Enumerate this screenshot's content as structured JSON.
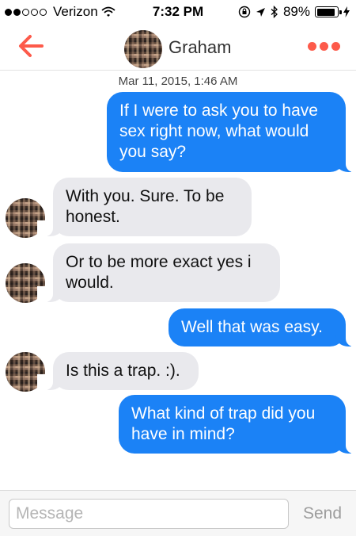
{
  "status_bar": {
    "carrier": "Verizon",
    "time": "7:32 PM",
    "battery": "89%",
    "battery_level": 0.89,
    "signal_bars": 2
  },
  "header": {
    "contact_name": "Graham",
    "accent_color": "#fd5a4a"
  },
  "conversation": {
    "timestamp": "Mar 11, 2015, 1:46 AM",
    "messages": [
      {
        "direction": "outgoing",
        "text": "If I were to ask you to have sex right now, what would you say?"
      },
      {
        "direction": "incoming",
        "text": "With you. Sure. To be honest."
      },
      {
        "direction": "incoming",
        "text": "Or to be more exact yes i would."
      },
      {
        "direction": "outgoing",
        "text": "Well that was easy."
      },
      {
        "direction": "incoming",
        "text": "Is this a trap. :)."
      },
      {
        "direction": "outgoing",
        "text": "What kind of trap did you have in mind?"
      }
    ],
    "outgoing_color": "#1b82f6",
    "incoming_color": "#e9e9ed"
  },
  "composer": {
    "placeholder": "Message",
    "send_label": "Send"
  }
}
